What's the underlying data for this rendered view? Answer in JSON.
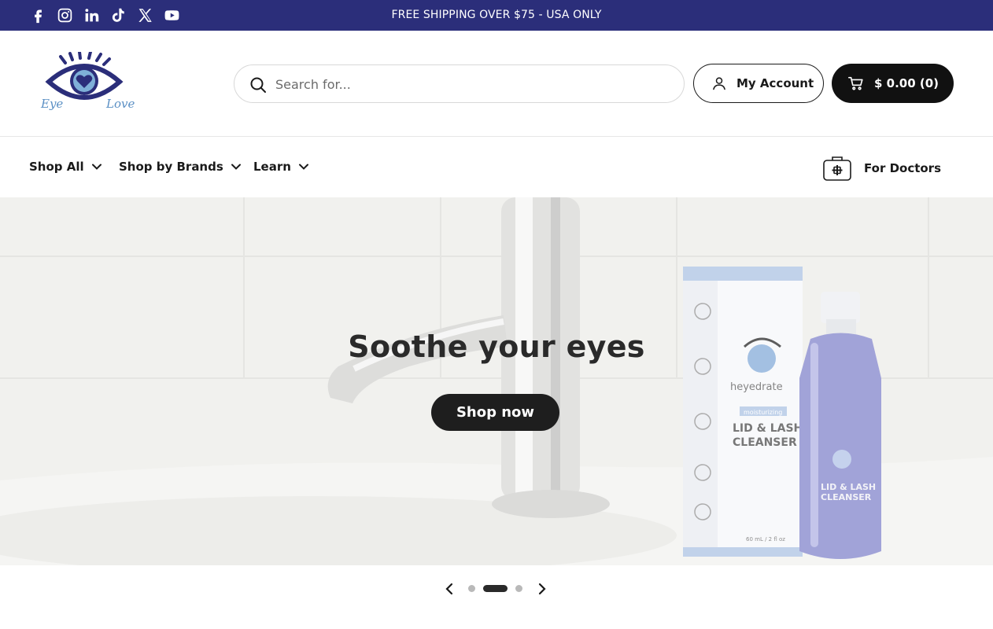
{
  "topbar": {
    "announcement": "FREE SHIPPING OVER $75 - USA ONLY",
    "social_icons": [
      "facebook-icon",
      "instagram-icon",
      "linkedin-icon",
      "tiktok-icon",
      "x-icon",
      "youtube-icon"
    ]
  },
  "header": {
    "logo_text_left": "Eye",
    "logo_text_right": "Love",
    "search_placeholder": "Search for...",
    "account_label": "My Account",
    "cart_label": "$ 0.00 (0)"
  },
  "nav": {
    "items": [
      {
        "label": "Shop All"
      },
      {
        "label": "Shop by Brands"
      },
      {
        "label": "Learn"
      }
    ],
    "doctors_label": "For Doctors"
  },
  "hero": {
    "title": "Soothe your eyes",
    "button_label": "Shop now",
    "product_brand": "heyedrate",
    "product_tag": "moisturizing",
    "product_name_line1": "LID & LASH",
    "product_name_line2": "CLEANSER",
    "product_volume": "60 mL / 2 fl oz"
  },
  "slider": {
    "slide_count": 3,
    "active_slide": 2
  },
  "colors": {
    "topbar_bg": "#2b2e7a",
    "accent_dark": "#111111",
    "logo_blue": "#2b2e7a",
    "logo_light_blue": "#7fb0d8"
  }
}
